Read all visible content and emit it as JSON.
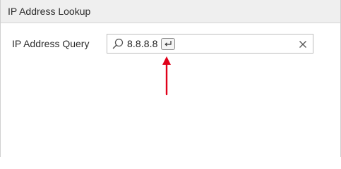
{
  "window": {
    "title": "IP Address Lookup"
  },
  "form": {
    "label": "IP Address Query",
    "search": {
      "value": "8.8.8.8",
      "icon": "search-icon",
      "enter_icon": "enter-key-icon",
      "clear_icon": "close-icon"
    }
  },
  "annotation": {
    "arrow_color": "#e0001a",
    "icon": "arrow-up-icon"
  }
}
